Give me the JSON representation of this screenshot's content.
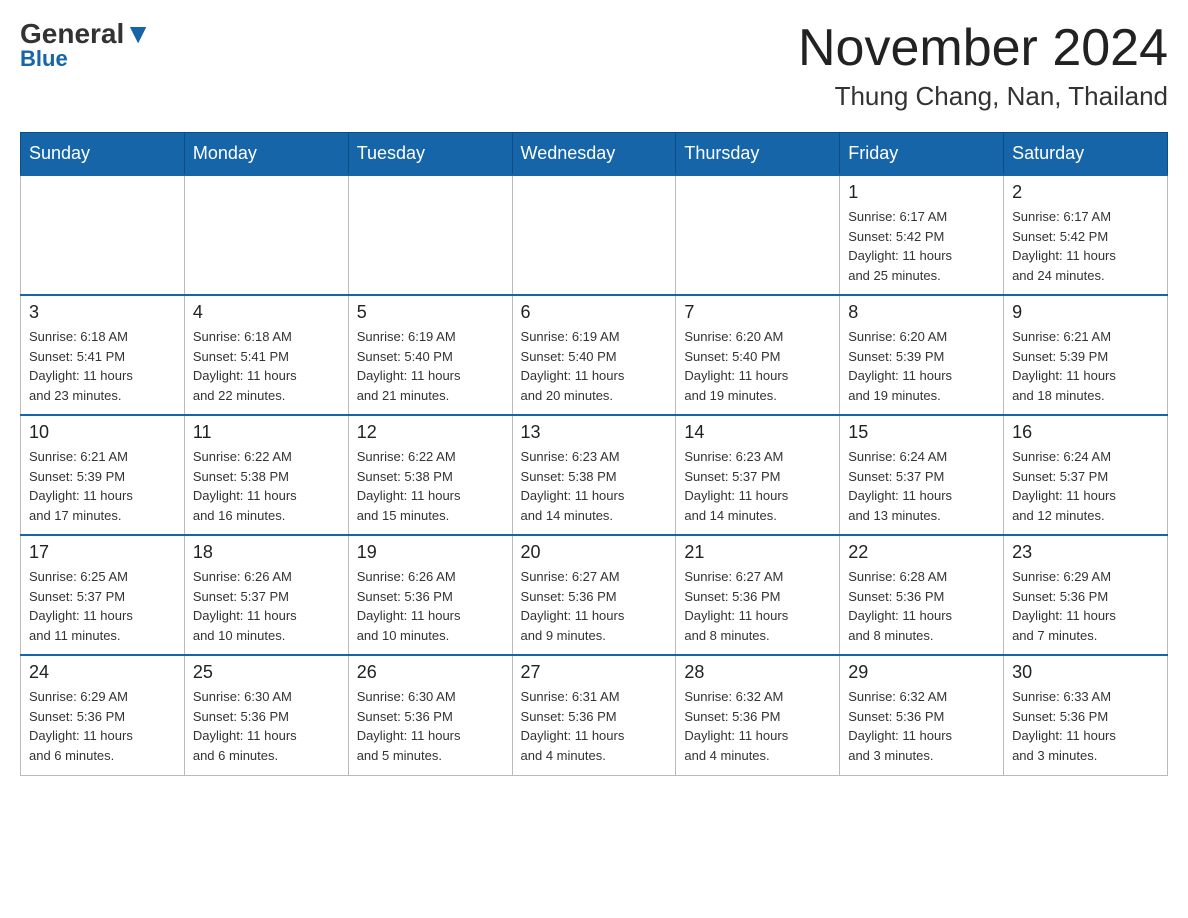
{
  "header": {
    "logo": {
      "general": "General",
      "blue": "Blue"
    },
    "title": "November 2024",
    "location": "Thung Chang, Nan, Thailand"
  },
  "calendar": {
    "days_of_week": [
      "Sunday",
      "Monday",
      "Tuesday",
      "Wednesday",
      "Thursday",
      "Friday",
      "Saturday"
    ],
    "weeks": [
      [
        {
          "day": "",
          "info": ""
        },
        {
          "day": "",
          "info": ""
        },
        {
          "day": "",
          "info": ""
        },
        {
          "day": "",
          "info": ""
        },
        {
          "day": "",
          "info": ""
        },
        {
          "day": "1",
          "info": "Sunrise: 6:17 AM\nSunset: 5:42 PM\nDaylight: 11 hours\nand 25 minutes."
        },
        {
          "day": "2",
          "info": "Sunrise: 6:17 AM\nSunset: 5:42 PM\nDaylight: 11 hours\nand 24 minutes."
        }
      ],
      [
        {
          "day": "3",
          "info": "Sunrise: 6:18 AM\nSunset: 5:41 PM\nDaylight: 11 hours\nand 23 minutes."
        },
        {
          "day": "4",
          "info": "Sunrise: 6:18 AM\nSunset: 5:41 PM\nDaylight: 11 hours\nand 22 minutes."
        },
        {
          "day": "5",
          "info": "Sunrise: 6:19 AM\nSunset: 5:40 PM\nDaylight: 11 hours\nand 21 minutes."
        },
        {
          "day": "6",
          "info": "Sunrise: 6:19 AM\nSunset: 5:40 PM\nDaylight: 11 hours\nand 20 minutes."
        },
        {
          "day": "7",
          "info": "Sunrise: 6:20 AM\nSunset: 5:40 PM\nDaylight: 11 hours\nand 19 minutes."
        },
        {
          "day": "8",
          "info": "Sunrise: 6:20 AM\nSunset: 5:39 PM\nDaylight: 11 hours\nand 19 minutes."
        },
        {
          "day": "9",
          "info": "Sunrise: 6:21 AM\nSunset: 5:39 PM\nDaylight: 11 hours\nand 18 minutes."
        }
      ],
      [
        {
          "day": "10",
          "info": "Sunrise: 6:21 AM\nSunset: 5:39 PM\nDaylight: 11 hours\nand 17 minutes."
        },
        {
          "day": "11",
          "info": "Sunrise: 6:22 AM\nSunset: 5:38 PM\nDaylight: 11 hours\nand 16 minutes."
        },
        {
          "day": "12",
          "info": "Sunrise: 6:22 AM\nSunset: 5:38 PM\nDaylight: 11 hours\nand 15 minutes."
        },
        {
          "day": "13",
          "info": "Sunrise: 6:23 AM\nSunset: 5:38 PM\nDaylight: 11 hours\nand 14 minutes."
        },
        {
          "day": "14",
          "info": "Sunrise: 6:23 AM\nSunset: 5:37 PM\nDaylight: 11 hours\nand 14 minutes."
        },
        {
          "day": "15",
          "info": "Sunrise: 6:24 AM\nSunset: 5:37 PM\nDaylight: 11 hours\nand 13 minutes."
        },
        {
          "day": "16",
          "info": "Sunrise: 6:24 AM\nSunset: 5:37 PM\nDaylight: 11 hours\nand 12 minutes."
        }
      ],
      [
        {
          "day": "17",
          "info": "Sunrise: 6:25 AM\nSunset: 5:37 PM\nDaylight: 11 hours\nand 11 minutes."
        },
        {
          "day": "18",
          "info": "Sunrise: 6:26 AM\nSunset: 5:37 PM\nDaylight: 11 hours\nand 10 minutes."
        },
        {
          "day": "19",
          "info": "Sunrise: 6:26 AM\nSunset: 5:36 PM\nDaylight: 11 hours\nand 10 minutes."
        },
        {
          "day": "20",
          "info": "Sunrise: 6:27 AM\nSunset: 5:36 PM\nDaylight: 11 hours\nand 9 minutes."
        },
        {
          "day": "21",
          "info": "Sunrise: 6:27 AM\nSunset: 5:36 PM\nDaylight: 11 hours\nand 8 minutes."
        },
        {
          "day": "22",
          "info": "Sunrise: 6:28 AM\nSunset: 5:36 PM\nDaylight: 11 hours\nand 8 minutes."
        },
        {
          "day": "23",
          "info": "Sunrise: 6:29 AM\nSunset: 5:36 PM\nDaylight: 11 hours\nand 7 minutes."
        }
      ],
      [
        {
          "day": "24",
          "info": "Sunrise: 6:29 AM\nSunset: 5:36 PM\nDaylight: 11 hours\nand 6 minutes."
        },
        {
          "day": "25",
          "info": "Sunrise: 6:30 AM\nSunset: 5:36 PM\nDaylight: 11 hours\nand 6 minutes."
        },
        {
          "day": "26",
          "info": "Sunrise: 6:30 AM\nSunset: 5:36 PM\nDaylight: 11 hours\nand 5 minutes."
        },
        {
          "day": "27",
          "info": "Sunrise: 6:31 AM\nSunset: 5:36 PM\nDaylight: 11 hours\nand 4 minutes."
        },
        {
          "day": "28",
          "info": "Sunrise: 6:32 AM\nSunset: 5:36 PM\nDaylight: 11 hours\nand 4 minutes."
        },
        {
          "day": "29",
          "info": "Sunrise: 6:32 AM\nSunset: 5:36 PM\nDaylight: 11 hours\nand 3 minutes."
        },
        {
          "day": "30",
          "info": "Sunrise: 6:33 AM\nSunset: 5:36 PM\nDaylight: 11 hours\nand 3 minutes."
        }
      ]
    ]
  }
}
